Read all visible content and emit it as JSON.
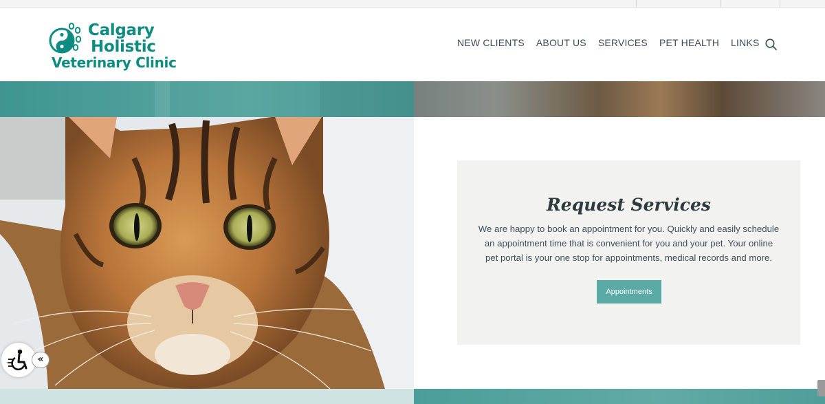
{
  "logo": {
    "line1": "Calgary",
    "line2": "Holistic",
    "line3": "Veterinary Clinic",
    "icon": "yin-yang-paw-icon"
  },
  "nav": {
    "items": [
      {
        "label": "NEW CLIENTS"
      },
      {
        "label": "ABOUT US"
      },
      {
        "label": "SERVICES"
      },
      {
        "label": "PET HEALTH"
      },
      {
        "label": "LINKS"
      }
    ],
    "search_icon": "search-icon"
  },
  "hero": {
    "image": "tabby-cat-photo"
  },
  "request_card": {
    "title": "Request Services",
    "body": "We are happy to book an appointment for you. Quickly and easily schedule an appointment time that is convenient for you and your pet. Your online pet portal is your one stop for appointments, medical records and more.",
    "button_label": "Appointments"
  },
  "accessibility": {
    "icon": "wheelchair-icon",
    "toggle_label": "«"
  },
  "colors": {
    "brand_teal": "#0f8c82",
    "button_teal": "#5aaaa5",
    "card_bg": "#f2f2f0"
  }
}
